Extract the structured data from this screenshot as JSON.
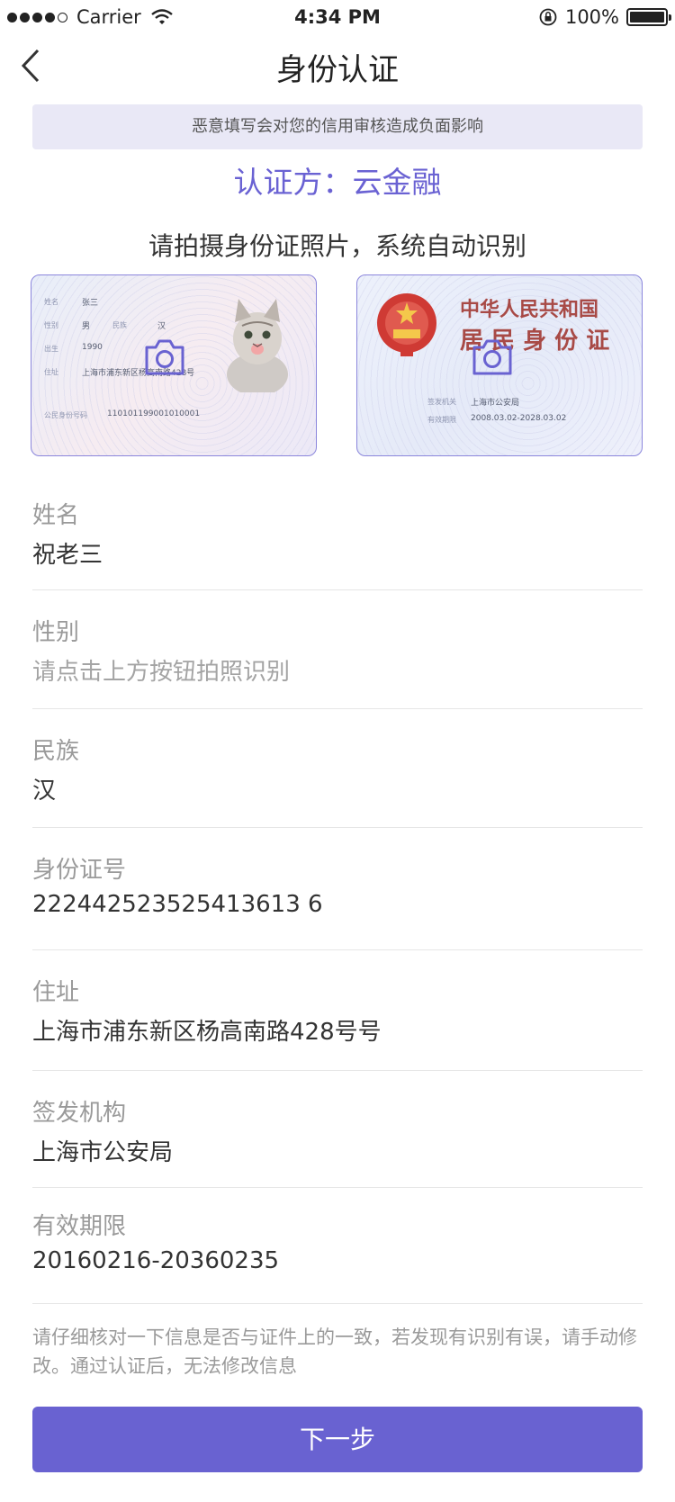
{
  "status_bar": {
    "carrier": "Carrier",
    "time": "4:34 PM",
    "battery": "100%"
  },
  "nav": {
    "title": "身份认证"
  },
  "warning": "恶意填写会对您的信用审核造成负面影响",
  "certifier": "认证方：云金融",
  "instruction": "请拍摄身份证照片，系统自动识别",
  "id_front": {
    "name_label": "姓名",
    "name": "张三",
    "gender_label": "性别",
    "gender": "男",
    "ethnicity_label": "民族",
    "ethnicity": "汉",
    "birth_label": "出生",
    "birth": "1990",
    "address_label": "住址",
    "address": "上海市浦东新区杨高南路428号",
    "id_label": "公民身份号码",
    "id_number": "110101199001010001"
  },
  "id_back": {
    "title_line1": "中华人民共和国",
    "title_line2": "居 民 身 份 证",
    "authority_label": "签发机关",
    "authority": "上海市公安局",
    "valid_label": "有效期限",
    "valid": "2008.03.02-2028.03.02"
  },
  "form": {
    "fields": [
      {
        "label": "姓名",
        "value": "祝老三"
      },
      {
        "label": "性别",
        "value": "请点击上方按钮拍照识别"
      },
      {
        "label": "民族",
        "value": "汉"
      },
      {
        "label": "身份证号",
        "value": "222442523525413613 6"
      },
      {
        "label": "住址",
        "value": "上海市浦东新区杨高南路428号号"
      },
      {
        "label": "签发机构",
        "value": "上海市公安局"
      },
      {
        "label": "有效期限",
        "value": "20160216-20360235"
      }
    ]
  },
  "notice": "请仔细核对一下信息是否与证件上的一致，若发现有识别有误，请手动修改。通过认证后，无法修改信息",
  "next_button": "下一步",
  "colors": {
    "accent": "#6962d1",
    "certifier": "#6a62d3",
    "warning_bg": "#e9e8f6"
  },
  "icons": [
    "back-chevron-icon",
    "camera-icon",
    "wifi-icon",
    "lock-rotation-icon",
    "battery-icon"
  ]
}
